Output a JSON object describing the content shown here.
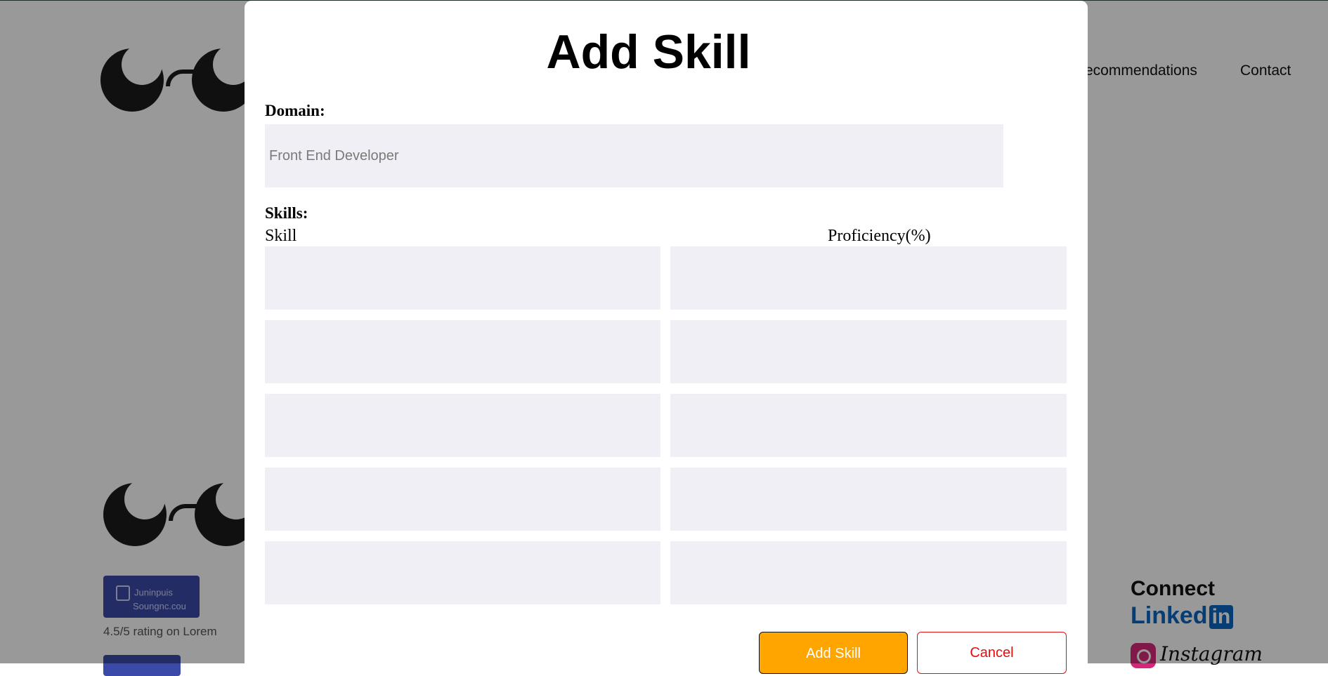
{
  "background": {
    "nav": {
      "recommendations": "ecommendations",
      "contact": "Contact"
    },
    "badge_text": [
      "Juninpuis",
      "Soungnc.cou"
    ],
    "rating": "4.5/5 rating on Lorem",
    "connect": {
      "title": "Connect",
      "linkedin": "Linked",
      "linkedin_in": "in",
      "instagram": "Instagram"
    }
  },
  "modal": {
    "title": "Add Skill",
    "domain_label": "Domain:",
    "domain_placeholder": "Front End Developer",
    "skills_label": "Skills:",
    "columns": {
      "skill": "Skill",
      "proficiency": "Proficiency(%)"
    },
    "rows": [
      {
        "skill": "",
        "proficiency": ""
      },
      {
        "skill": "",
        "proficiency": ""
      },
      {
        "skill": "",
        "proficiency": ""
      },
      {
        "skill": "",
        "proficiency": ""
      },
      {
        "skill": "",
        "proficiency": ""
      }
    ],
    "buttons": {
      "add": "Add Skill",
      "cancel": "Cancel"
    }
  },
  "colors": {
    "add_button": "#ffa500",
    "cancel_text": "#e01010",
    "input_bg": "#efeff5"
  },
  "icons": [
    "glasses-logo-icon",
    "linkedin-icon",
    "instagram-icon"
  ]
}
